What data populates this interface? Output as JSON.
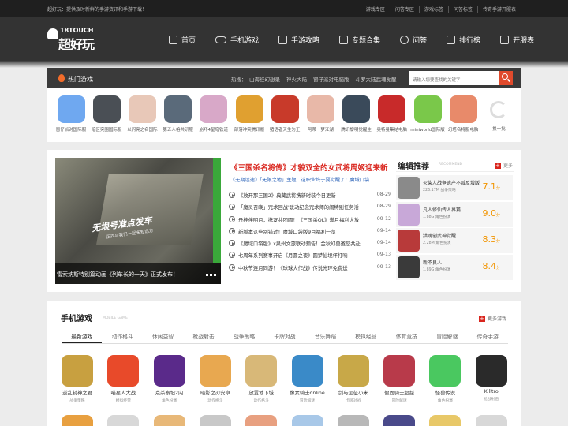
{
  "topbar": {
    "welcome": "超好玩：提供及时新鲜的手游资讯和手游下载！",
    "links": [
      "游戏专区",
      "问答专区",
      "游戏标签",
      "问答标签",
      "传奇手游开服表"
    ]
  },
  "header": {
    "logo_top": "18TOUCH",
    "logo_main": "超好玩",
    "nav": [
      {
        "label": "首页",
        "icon": "home-icon"
      },
      {
        "label": "手机游戏",
        "icon": "gamepad-icon"
      },
      {
        "label": "手游攻略",
        "icon": "phone-icon"
      },
      {
        "label": "专题合集",
        "icon": "collection-icon"
      },
      {
        "label": "问答",
        "icon": "question-icon"
      },
      {
        "label": "排行榜",
        "icon": "trophy-icon"
      },
      {
        "label": "开服表",
        "icon": "flag-icon"
      }
    ]
  },
  "hotbar": {
    "title": "热门游戏",
    "hot_label": "热搜：",
    "hot_words": [
      "山海经幻想录",
      "神火大陆",
      "窗仔派对电脑版",
      "斗罗大陆武魂觉醒"
    ],
    "search_placeholder": "请输入您要查找的关键字"
  },
  "hot_games": [
    {
      "name": "窗仔派对国际服",
      "color": "#6fa8f0"
    },
    {
      "name": "暗区突围国际服",
      "color": "#4a4f55"
    },
    {
      "name": "以闪亮之名国际",
      "color": "#e8c8b8"
    },
    {
      "name": "第五人格共研服",
      "color": "#5a6a7a"
    },
    {
      "name": "崩坏4星穹铁道",
      "color": "#d8a8c8"
    },
    {
      "name": "部落冲突腾讯版",
      "color": "#e0a030"
    },
    {
      "name": "猪语者天生为王",
      "color": "#c83a2a"
    },
    {
      "name": "阿蒂一梦江湖",
      "color": "#e8b8a8"
    },
    {
      "name": "腾讯黎明觉醒生",
      "color": "#3a4a5a"
    },
    {
      "name": "奥特曼集结电脑",
      "color": "#c82a2a"
    },
    {
      "name": "miniworld国际版",
      "color": "#7ac84a"
    },
    {
      "name": "幻塔名将服电脑",
      "color": "#e88a6a"
    },
    {
      "name": "换一批",
      "color": ""
    }
  ],
  "slide": {
    "overlay_title": "无垠号准点发车",
    "overlay_sub": "正式与我们一起未知远方",
    "caption": "雷索纳斯特别篇动画《列车长的一天》正式发布！"
  },
  "news": {
    "headline": "《三国杀名将传》才貌双全的女武将周姬迎来新",
    "sublinks": [
      "《无期迷途》「无限之地」主题",
      "这职业终于要觉醒了！魔域口袋"
    ],
    "items": [
      {
        "title": "《放开那三国2》典藏武将携新时装今日更新",
        "date": "08-29"
      },
      {
        "title": "「魔灵召唤」咒术回战'联动纪念咒术师的闹特别任务活",
        "date": "08-29"
      },
      {
        "title": "丹桂伴明月，携友共团圆！《三国杀OL》满月福利大放",
        "date": "09-12"
      },
      {
        "title": "新版本这些别错过！魔域口袋版9月福利一览",
        "date": "09-14"
      },
      {
        "title": "《魔域口袋版》x泉州文旅联动预告！金秋幻兽邀您共赴",
        "date": "09-14"
      },
      {
        "title": "七周年系列赛事开启《月圆之夜》圆梦仙境杯打响",
        "date": "09-13"
      },
      {
        "title": "中秋节连月同游！《球球大作战》传说光环免费送",
        "date": "09-13"
      }
    ]
  },
  "editor": {
    "title": "编辑推荐",
    "en": "RECOMMEND",
    "more": "更多",
    "score_unit": "分",
    "items": [
      {
        "name": "火柴人战争遗产不减反增版",
        "meta": "226.17M 战争策略",
        "score": "7.1",
        "color": "#8a8a8a"
      },
      {
        "name": "凡人修仙传人界篇",
        "meta": "1.88G 角色扮演",
        "score": "9.0",
        "color": "#c8a8d8"
      },
      {
        "name": "猎魂创武神觉醒",
        "meta": "2.28M 角色扮演",
        "score": "8.3",
        "color": "#b83a3a"
      },
      {
        "name": "新不良人",
        "meta": "1.89G 角色扮演",
        "score": "8.4",
        "color": "#3a3a3a"
      }
    ]
  },
  "mobile": {
    "title": "手机游戏",
    "en": "MOBILE GAME",
    "more": "更多游戏",
    "tabs": [
      "最新游戏",
      "动作格斗",
      "休闲益智",
      "枪战射击",
      "战争策略",
      "卡牌对战",
      "音乐舞蹈",
      "模拟经营",
      "体育竞技",
      "冒险解谜",
      "传奇手游"
    ],
    "games": [
      {
        "name": "逆乱封神之君",
        "cat": "战争策略",
        "color": "#c8a040"
      },
      {
        "name": "喵星人大战",
        "cat": "模拟经营",
        "color": "#e84a2a"
      },
      {
        "name": "点杀泰坦2内",
        "cat": "角色扮演",
        "color": "#5a2a8a"
      },
      {
        "name": "暗影之刃安卓",
        "cat": "动作格斗",
        "color": "#e8a850"
      },
      {
        "name": "放置地下城",
        "cat": "动作格斗",
        "color": "#d8b878"
      },
      {
        "name": "像素骑士online",
        "cat": "冒险解谜",
        "color": "#3a8ac8"
      },
      {
        "name": "剑与远征小米",
        "cat": "卡牌对战",
        "color": "#c8a848"
      },
      {
        "name": "假面骑士超越",
        "cat": "冒险解谜",
        "color": "#b83a4a"
      },
      {
        "name": "怪兽传说",
        "cat": "角色扮演",
        "color": "#4ac860"
      },
      {
        "name": "Killtro",
        "cat": "枪战射击",
        "color": "#2a2a2a"
      }
    ]
  }
}
